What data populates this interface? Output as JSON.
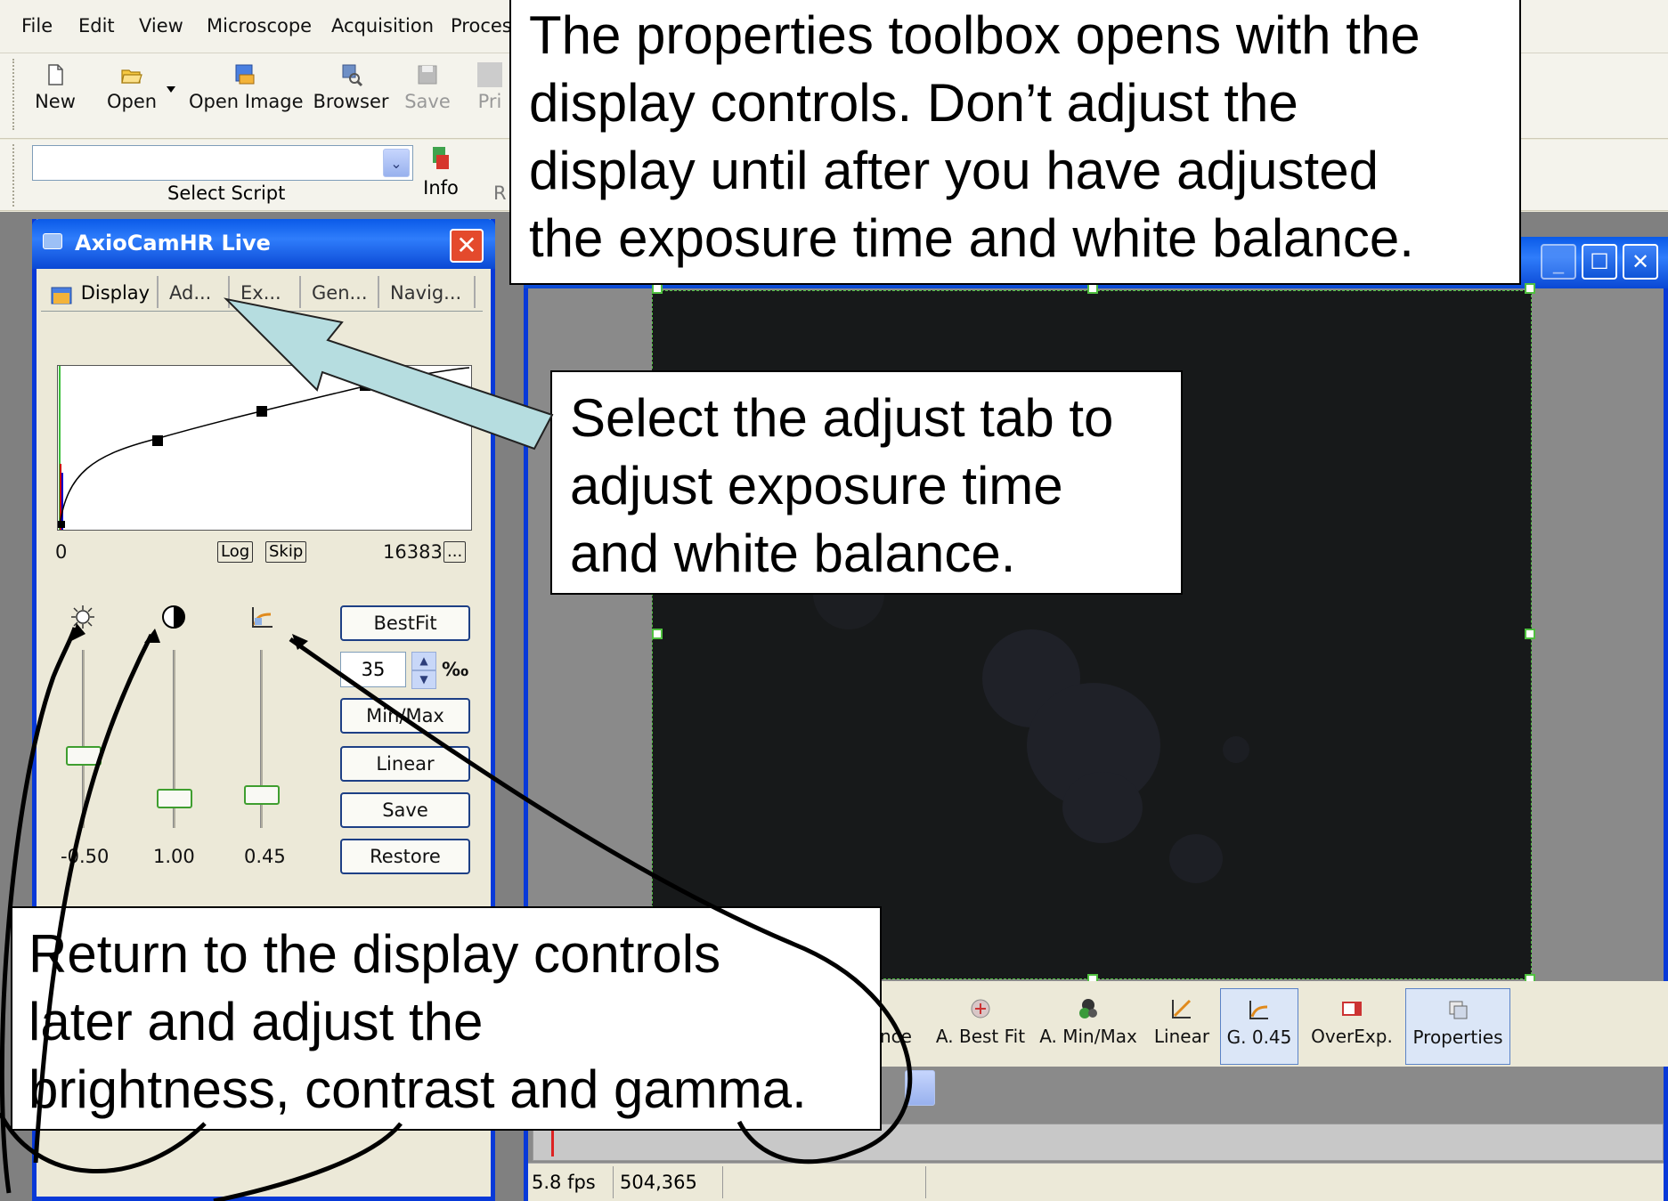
{
  "menu": [
    "File",
    "Edit",
    "View",
    "Microscope",
    "Acquisition",
    "Proces"
  ],
  "toolbar": {
    "new": "New",
    "open": "Open",
    "open_image": "Open Image",
    "browser": "Browser",
    "save": "Save",
    "print_partial": "Pri"
  },
  "scriptbar": {
    "select_script": "Select Script",
    "info": "Info",
    "partial": "R"
  },
  "tool_window": {
    "title": "AxioCamHR Live",
    "tabs": [
      "Display",
      "Ad...",
      "Ex...",
      "Gen...",
      "Navig..."
    ],
    "hist_min": "0",
    "hist_max": "16383",
    "log_btn": "Log",
    "skip_btn": "Skip",
    "more_btn": "...",
    "brightness_value": "-0.50",
    "contrast_value": "1.00",
    "gamma_value": "0.45",
    "bestfit": "BestFit",
    "spin_value": "35",
    "spin_unit": "‰",
    "minmax": "Min/Max",
    "linear": "Linear",
    "save": "Save",
    "restore": "Restore"
  },
  "bottom_toolbar": {
    "partial": "nce",
    "best_fit": "A. Best Fit",
    "min_max": "A. Min/Max",
    "linear": "Linear",
    "gamma": "G. 0.45",
    "overexp": "OverExp.",
    "properties": "Properties"
  },
  "status": {
    "fps": "5.8 fps",
    "coords": "504,365"
  },
  "callouts": {
    "top": [
      "The properties toolbox opens with the",
      "display controls.  Don’t adjust the",
      "display until after you have adjusted",
      "the exposure time and white balance."
    ],
    "middle": [
      "Select the adjust tab to",
      "adjust exposure time",
      "and white balance."
    ],
    "bottom": [
      "Return to the display controls",
      "later and adjust the",
      "brightness, contrast and gamma."
    ]
  },
  "icons": [
    "new-icon",
    "open-icon",
    "open-image-icon",
    "browser-icon",
    "save-icon",
    "info-icon",
    "brightness-icon",
    "contrast-icon",
    "gamma-icon",
    "display-tab-icon",
    "close-icon",
    "minimize-icon",
    "maximize-icon"
  ],
  "colors": {
    "xp_blue": "#0a5ae8",
    "arrow_fill": "#b6dde0",
    "close_red": "#e44a2c",
    "slider_green": "#3f9e2f"
  }
}
